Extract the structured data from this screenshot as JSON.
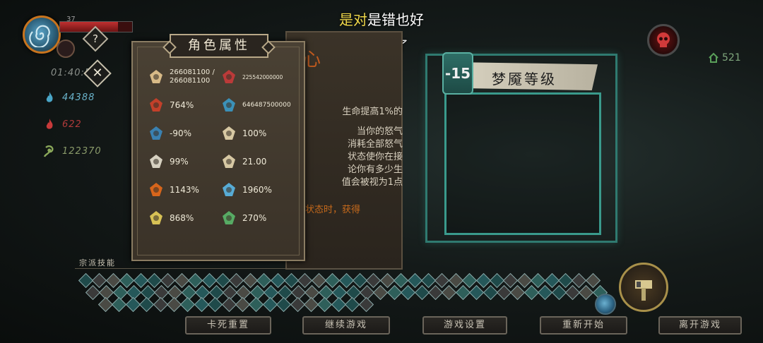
{
  "hud": {
    "level": "37",
    "hp_fraction": 0.8,
    "timer": "01:40:50",
    "resources": [
      {
        "name": "blue-flame",
        "value": "44388",
        "color": "#4aa6c8"
      },
      {
        "name": "red-flame",
        "value": "622",
        "color": "#c83a3a"
      },
      {
        "name": "green-soul",
        "value": "122370",
        "color": "#8aa85a"
      }
    ],
    "help_label": "?",
    "close_label": "✕"
  },
  "subtitle": {
    "part1": "是对",
    "part2": "是错也好",
    "line2": "不必说了"
  },
  "souls": {
    "value": "521"
  },
  "desc": {
    "title": "心",
    "lines": [
      "生命提高1%的",
      "当你的怒气",
      "消耗全部怒气",
      "状态使你在接",
      "论你有多少生",
      "值会被视为1点"
    ],
    "footer": "状态时，获得"
  },
  "attributes": {
    "title": "角色属性",
    "stats": [
      {
        "icon": "heart-icon",
        "value": "266081100 / 266081100",
        "cls": "two"
      },
      {
        "icon": "sword-icon",
        "value": "225542000000",
        "cls": "tiny"
      },
      {
        "icon": "claw-icon",
        "value": "764%",
        "cls": ""
      },
      {
        "icon": "crit-icon",
        "value": "646487500000",
        "cls": "small"
      },
      {
        "icon": "cooldown-icon",
        "value": "-90%",
        "cls": ""
      },
      {
        "icon": "dodge-icon",
        "value": "100%",
        "cls": ""
      },
      {
        "icon": "shield-icon",
        "value": "99%",
        "cls": ""
      },
      {
        "icon": "luck-icon",
        "value": "21.00",
        "cls": ""
      },
      {
        "icon": "fire-icon",
        "value": "1143%",
        "cls": ""
      },
      {
        "icon": "ice-icon",
        "value": "1960%",
        "cls": ""
      },
      {
        "icon": "lightning-icon",
        "value": "868%",
        "cls": ""
      },
      {
        "icon": "poison-icon",
        "value": "270%",
        "cls": ""
      }
    ]
  },
  "nightmare": {
    "badge": "-15",
    "title": "梦魇等级"
  },
  "skills": {
    "label": "宗派技能",
    "count": 96
  },
  "menu": [
    {
      "id": "reset",
      "label": "卡死重置"
    },
    {
      "id": "continue",
      "label": "继续游戏"
    },
    {
      "id": "settings",
      "label": "游戏设置"
    },
    {
      "id": "restart",
      "label": "重新开始"
    },
    {
      "id": "quit",
      "label": "离开游戏"
    }
  ]
}
